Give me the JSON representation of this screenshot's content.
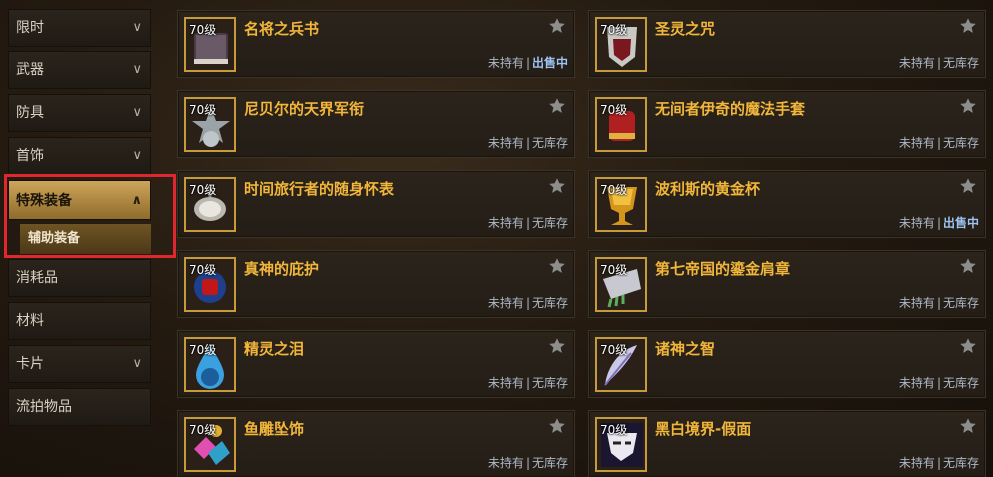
{
  "sidebar": {
    "items": [
      {
        "label": "限时",
        "chevron": "chevron-down"
      },
      {
        "label": "武器",
        "chevron": "chevron-down"
      },
      {
        "label": "防具",
        "chevron": "chevron-down"
      },
      {
        "label": "首饰",
        "chevron": "chevron-down"
      },
      {
        "label": "特殊装备",
        "chevron": "chevron-up",
        "active": true
      },
      {
        "label": "消耗品"
      },
      {
        "label": "材料"
      },
      {
        "label": "卡片",
        "chevron": "chevron-down"
      },
      {
        "label": "流拍物品"
      }
    ],
    "sub_item": {
      "label": "辅助装备"
    },
    "chevron_down": "∨",
    "chevron_up": "∧"
  },
  "items": [
    {
      "level": "70级",
      "name": "名将之兵书",
      "owned": "未持有",
      "stock": "出售中",
      "icon": "book-icon"
    },
    {
      "level": "70级",
      "name": "圣灵之咒",
      "owned": "未持有",
      "stock": "无库存",
      "icon": "mask-icon"
    },
    {
      "level": "70级",
      "name": "尼贝尔的天界军衔",
      "owned": "未持有",
      "stock": "无库存",
      "icon": "star-badge-icon"
    },
    {
      "level": "70级",
      "name": "无间者伊奇的魔法手套",
      "owned": "未持有",
      "stock": "无库存",
      "icon": "glove-icon"
    },
    {
      "level": "70级",
      "name": "时间旅行者的随身怀表",
      "owned": "未持有",
      "stock": "无库存",
      "icon": "pocket-watch-icon"
    },
    {
      "level": "70级",
      "name": "波利斯的黄金杯",
      "owned": "未持有",
      "stock": "出售中",
      "icon": "golden-cup-icon"
    },
    {
      "level": "70级",
      "name": "真神的庇护",
      "owned": "未持有",
      "stock": "无库存",
      "icon": "amulet-icon"
    },
    {
      "level": "70级",
      "name": "第七帝国的鎏金肩章",
      "owned": "未持有",
      "stock": "无库存",
      "icon": "epaulette-icon"
    },
    {
      "level": "70级",
      "name": "精灵之泪",
      "owned": "未持有",
      "stock": "无库存",
      "icon": "teardrop-icon"
    },
    {
      "level": "70级",
      "name": "诸神之智",
      "owned": "未持有",
      "stock": "无库存",
      "icon": "feather-icon"
    },
    {
      "level": "70级",
      "name": "鱼雕坠饰",
      "owned": "未持有",
      "stock": "无库存",
      "icon": "pendant-icon"
    },
    {
      "level": "70级",
      "name": "黑白境界-假面",
      "owned": "未持有",
      "stock": "无库存",
      "icon": "masquerade-mask-icon"
    }
  ],
  "colors": {
    "accent": "#f1b63a",
    "highlight": "#e0262e",
    "on_sale": "#9ec3f2"
  },
  "status_separator": "|"
}
